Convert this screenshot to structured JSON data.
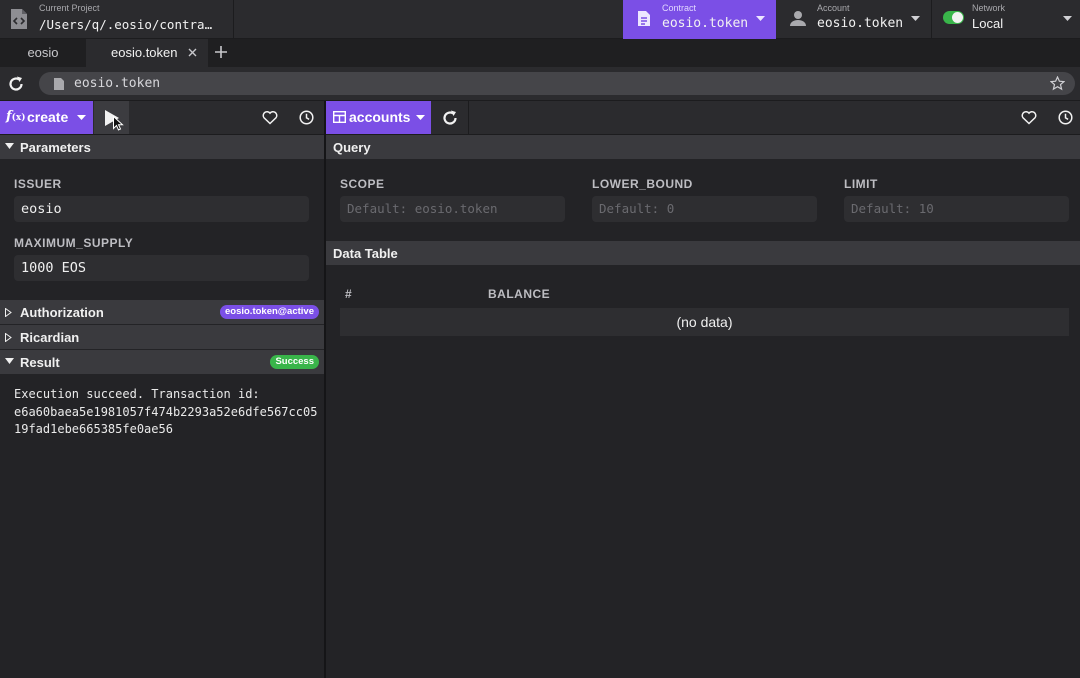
{
  "topbar": {
    "project": {
      "label": "Current Project",
      "value": "/Users/q/.eosio/contra…",
      "icon": "code-file-icon"
    },
    "contract": {
      "label": "Contract",
      "value": "eosio.token",
      "icon": "document-icon"
    },
    "account": {
      "label": "Account",
      "value": "eosio.token",
      "icon": "user-icon"
    },
    "network": {
      "label": "Network",
      "value": "Local",
      "enabled": true
    }
  },
  "tabs": [
    {
      "label": "eosio",
      "active": false
    },
    {
      "label": "eosio.token",
      "active": true,
      "closable": true
    }
  ],
  "address": {
    "url": "eosio.token"
  },
  "action_panel": {
    "function_name": "create",
    "fx_label": "f",
    "fx_sub": "(x)",
    "sections": {
      "parameters": "Parameters",
      "authorization": "Authorization",
      "ricardian": "Ricardian",
      "result": "Result"
    },
    "params": [
      {
        "label": "ISSUER",
        "value": "eosio"
      },
      {
        "label": "MAXIMUM_SUPPLY",
        "value": "1000 EOS"
      }
    ],
    "authorization_badge": "eosio.token@active",
    "result_badge": "Success",
    "result_lines": [
      "Execution succeed. Transaction id:",
      "e6a60baea5e1981057f474b2293a52e6dfe567cc05",
      "19fad1ebe665385fe0ae56"
    ]
  },
  "table_panel": {
    "table_name": "accounts",
    "query_title": "Query",
    "query_fields": [
      {
        "label": "SCOPE",
        "placeholder": "Default: eosio.token"
      },
      {
        "label": "LOWER_BOUND",
        "placeholder": "Default: 0"
      },
      {
        "label": "LIMIT",
        "placeholder": "Default: 10"
      }
    ],
    "data_table_title": "Data Table",
    "columns": [
      "#",
      "BALANCE"
    ],
    "empty_text": "(no data)"
  },
  "colors": {
    "accent": "#7b4fe6",
    "success": "#39b54a",
    "background": "#232326"
  }
}
